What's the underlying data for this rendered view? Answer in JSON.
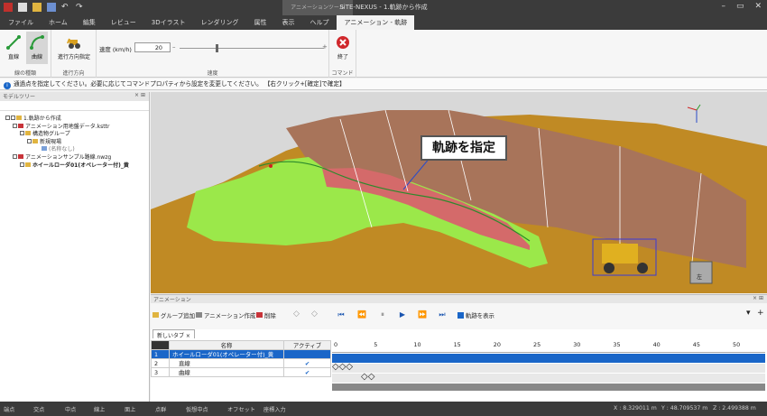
{
  "titlebar": {
    "app_title": "SiTE-NEXUS - 1.軌跡から作成",
    "context_tab": "アニメーションツール"
  },
  "tabs": [
    "ファイル",
    "ホーム",
    "編集",
    "レビュー",
    "3Dイラスト",
    "レンダリング",
    "属性",
    "表示",
    "ヘルプ",
    "アニメーション - 軌跡"
  ],
  "ribbon": {
    "line_type": {
      "straight": "直線",
      "curve": "曲線",
      "caption": "線の種類"
    },
    "direction": {
      "button": "進行方向指定",
      "caption": "進行方向"
    },
    "speed": {
      "label": "速度 (km/h)",
      "value": "20",
      "caption": "速度",
      "slider_fraction": 0.25
    },
    "command": {
      "exit": "終了",
      "caption": "コマンド"
    }
  },
  "infobar": {
    "message": "通過点を指定してください。必要に応じてコマンドプロパティから設定を変更してください。 【右クリック+[確定]で確定】"
  },
  "model_tree": {
    "title": "モデルツリー",
    "close": "× ⊞",
    "items": [
      {
        "label": "1.軌跡から作成",
        "level": 0
      },
      {
        "label": "アニメーション用地盤データ.ksttr",
        "level": 1
      },
      {
        "label": "構造物グループ",
        "level": 2
      },
      {
        "label": "新規現場",
        "level": 3
      },
      {
        "label": "(名称なし)",
        "level": 4
      },
      {
        "label": "アニメーションサンプル路線.nwzg",
        "level": 1
      },
      {
        "label": "ホイールローダ01(オペレーター付)_黄",
        "level": 1
      }
    ]
  },
  "viewport": {
    "callout": "軌跡を指定",
    "cube_face": "左"
  },
  "animation": {
    "title": "アニメーション",
    "add_group": "グループ追加",
    "create": "アニメーション作成",
    "delete": "削除",
    "show_track": "軌跡を表示",
    "tab": "新しいタブ",
    "columns": [
      "名称",
      "アクティブ"
    ],
    "rows": [
      {
        "no": "1",
        "name": "ホイールローダ01(オペレーター付)_黄",
        "active": ""
      },
      {
        "no": "2",
        "name": "直線",
        "active": "✔"
      },
      {
        "no": "3",
        "name": "曲線",
        "active": "✔"
      }
    ],
    "ticks": [
      "0",
      "5",
      "10",
      "15",
      "20",
      "25",
      "30",
      "35",
      "40",
      "45",
      "50"
    ]
  },
  "statusbar": {
    "snaps": [
      "端点",
      "交点",
      "中点",
      "線上",
      "面上",
      "点群",
      "仮想中点",
      "オフセット",
      "座標入力"
    ],
    "x": "X : 8.329011 m",
    "y": "Y : 48.709537 m",
    "z": "Z : 2.499388 m"
  }
}
